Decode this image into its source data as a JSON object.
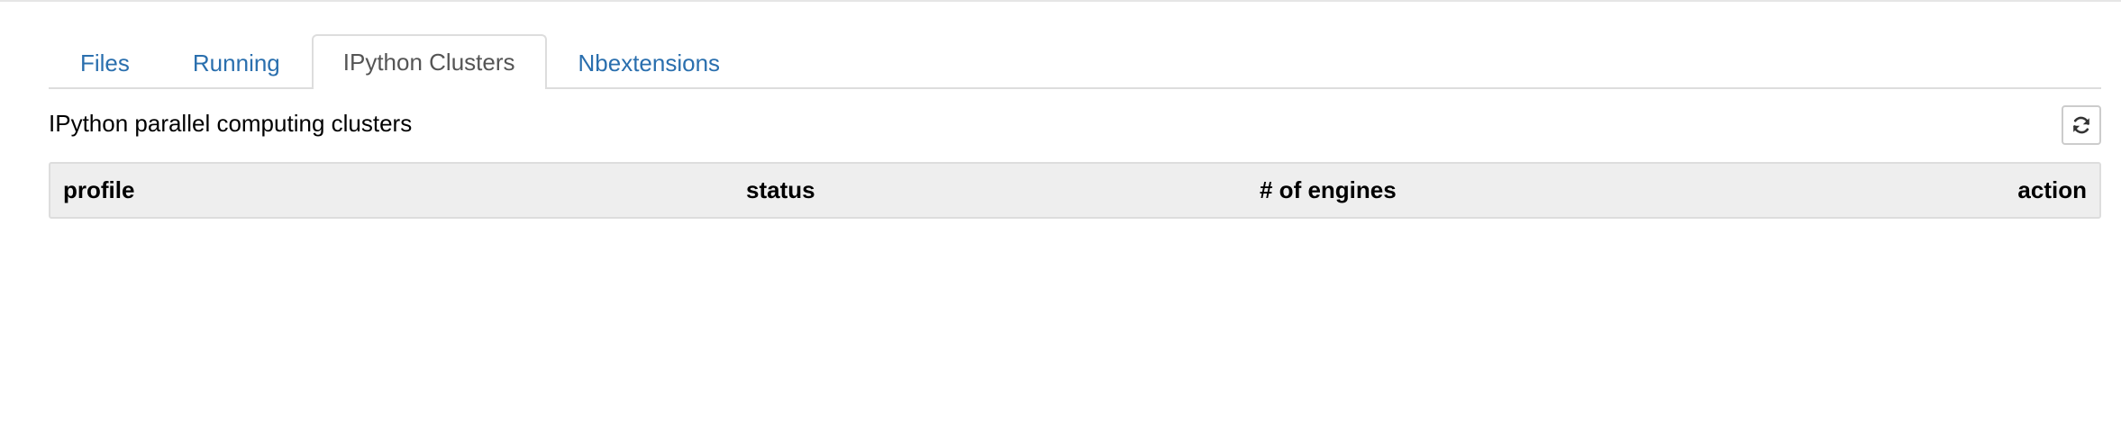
{
  "tabs": [
    {
      "label": "Files",
      "active": false
    },
    {
      "label": "Running",
      "active": false
    },
    {
      "label": "IPython Clusters",
      "active": true
    },
    {
      "label": "Nbextensions",
      "active": false
    }
  ],
  "clusters": {
    "title": "IPython parallel computing clusters",
    "refresh_icon": "refresh-icon",
    "columns": [
      "profile",
      "status",
      "# of engines",
      "action"
    ]
  },
  "colors": {
    "link": "#2a6fae",
    "active_tab_text": "#555555",
    "table_header_bg": "#eeeeee",
    "border": "#dddddd"
  }
}
